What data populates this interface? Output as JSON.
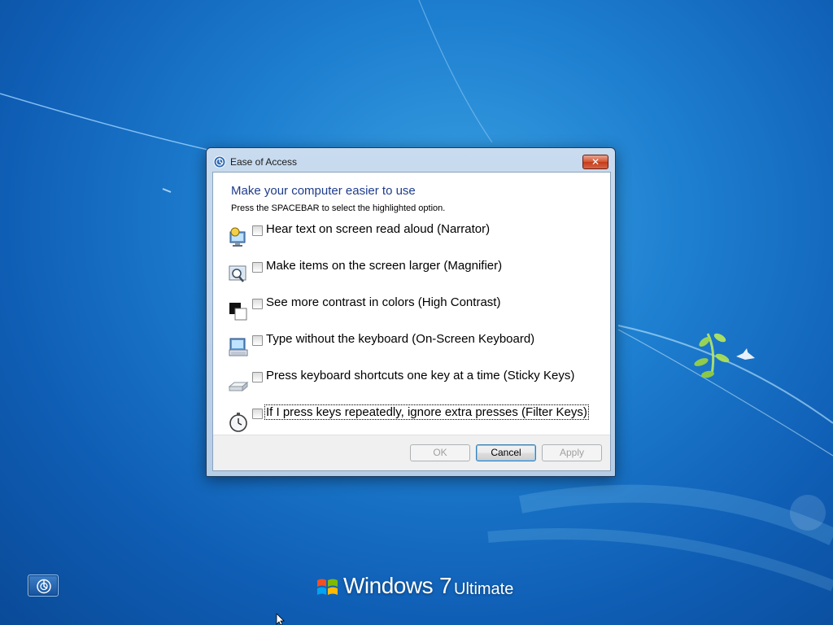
{
  "dialog": {
    "title": "Ease of Access",
    "close_label": "✕",
    "heading": "Make your computer easier to use",
    "instruction": "Press the SPACEBAR to select the highlighted option.",
    "options": [
      {
        "label": "Hear text on screen read aloud (Narrator)",
        "icon": "narrator-icon",
        "checked": false
      },
      {
        "label": "Make items on the screen larger (Magnifier)",
        "icon": "magnifier-icon",
        "checked": false
      },
      {
        "label": "See more contrast in colors (High Contrast)",
        "icon": "high-contrast-icon",
        "checked": false
      },
      {
        "label": "Type without the keyboard (On-Screen Keyboard)",
        "icon": "on-screen-keyboard-icon",
        "checked": false
      },
      {
        "label": "Press keyboard shortcuts one key at a time (Sticky Keys)",
        "icon": "sticky-keys-icon",
        "checked": false
      },
      {
        "label": "If I press keys repeatedly, ignore extra presses (Filter Keys)",
        "icon": "filter-keys-icon",
        "checked": false
      }
    ],
    "buttons": {
      "ok": "OK",
      "cancel": "Cancel",
      "apply": "Apply"
    }
  },
  "desktop": {
    "branding_word": "Windows",
    "branding_version": "7",
    "branding_edition": "Ultimate",
    "ease_of_access_icon": "ease-of-access-icon"
  }
}
